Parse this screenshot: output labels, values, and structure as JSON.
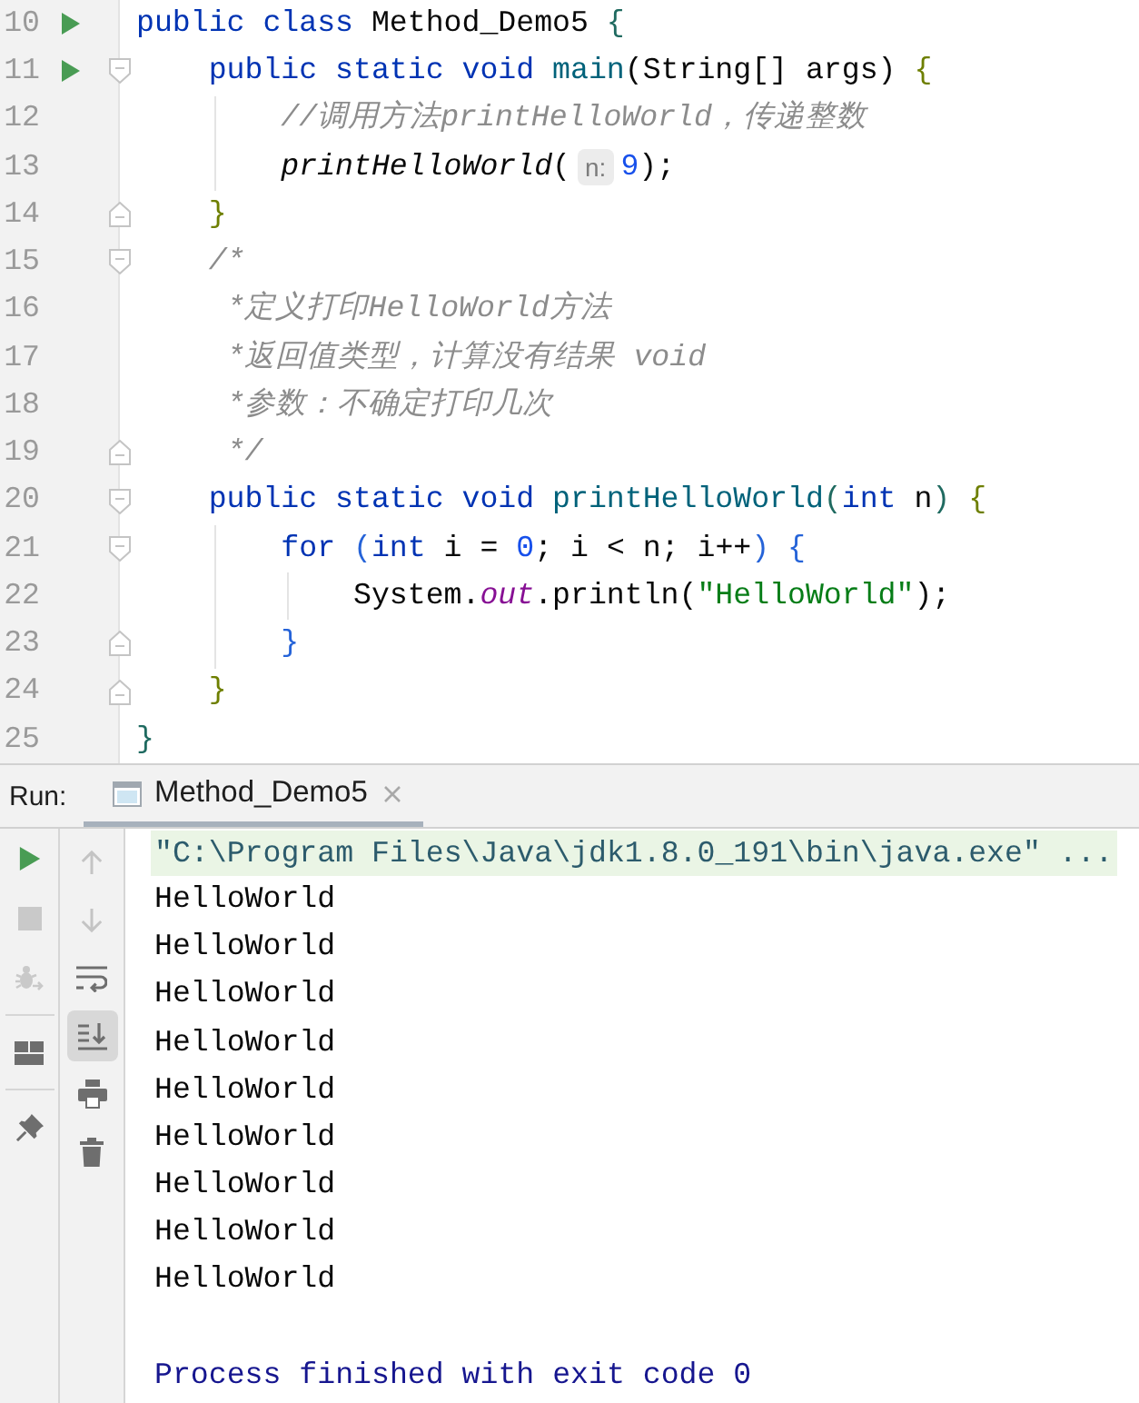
{
  "editor": {
    "lines": [
      {
        "number": "10",
        "run_marker": true,
        "tokens": [
          {
            "kind": "keyword",
            "text": "public class "
          },
          {
            "kind": "plain",
            "text": "Method_Demo5 "
          },
          {
            "kind": "brace-1",
            "text": "{"
          }
        ],
        "children": [
          {
            "number": "11",
            "run_marker": true,
            "fold_start": true,
            "tokens": [
              {
                "kind": "keyword",
                "text": "public static void "
              },
              {
                "kind": "method",
                "text": "main"
              },
              {
                "kind": "plain",
                "text": "(String[] args) "
              },
              {
                "kind": "brace-2",
                "text": "{"
              }
            ],
            "children": [
              {
                "number": "12",
                "tokens": [
                  {
                    "kind": "comment",
                    "text": "//调用方法printHelloWorld，传递整数"
                  }
                ]
              },
              {
                "number": "13",
                "tokens": [
                  {
                    "kind": "call",
                    "text": "printHelloWorld"
                  },
                  {
                    "kind": "plain",
                    "text": "("
                  },
                  {
                    "kind": "hint",
                    "text": "n:"
                  },
                  {
                    "kind": "number",
                    "text": "9"
                  },
                  {
                    "kind": "plain",
                    "text": ");"
                  }
                ]
              }
            ]
          },
          {
            "number": "14",
            "fold_end": true,
            "tokens": [
              {
                "kind": "brace-2",
                "text": "}"
              }
            ]
          },
          {
            "number": "15",
            "fold_start": true,
            "tokens": [
              {
                "kind": "comment",
                "text": "/*"
              }
            ]
          },
          {
            "number": "16",
            "tokens": [
              {
                "kind": "comment",
                "text": " *定义打印HelloWorld方法"
              }
            ]
          },
          {
            "number": "17",
            "tokens": [
              {
                "kind": "comment",
                "text": " *返回值类型，计算没有结果 void"
              }
            ]
          },
          {
            "number": "18",
            "tokens": [
              {
                "kind": "comment",
                "text": " *参数：不确定打印几次"
              }
            ]
          },
          {
            "number": "19",
            "fold_end": true,
            "tokens": [
              {
                "kind": "comment",
                "text": " */"
              }
            ]
          },
          {
            "number": "20",
            "fold_start": true,
            "tokens": [
              {
                "kind": "keyword",
                "text": "public static void "
              },
              {
                "kind": "method",
                "text": "printHelloWorld"
              },
              {
                "kind": "brace-1",
                "text": "("
              },
              {
                "kind": "keyword",
                "text": "int"
              },
              {
                "kind": "plain",
                "text": " n"
              },
              {
                "kind": "brace-1",
                "text": ")"
              },
              {
                "kind": "brace-2",
                "text": " {"
              }
            ],
            "children": [
              {
                "number": "21",
                "fold_start": true,
                "tokens": [
                  {
                    "kind": "keyword",
                    "text": "for "
                  },
                  {
                    "kind": "brace-3",
                    "text": "("
                  },
                  {
                    "kind": "keyword",
                    "text": "int"
                  },
                  {
                    "kind": "plain",
                    "text": " i = "
                  },
                  {
                    "kind": "number",
                    "text": "0"
                  },
                  {
                    "kind": "plain",
                    "text": "; i < n; i++"
                  },
                  {
                    "kind": "brace-3",
                    "text": ") {"
                  }
                ],
                "children": [
                  {
                    "number": "22",
                    "tokens": [
                      {
                        "kind": "plain",
                        "text": "System."
                      },
                      {
                        "kind": "field",
                        "text": "out"
                      },
                      {
                        "kind": "plain",
                        "text": ".println("
                      },
                      {
                        "kind": "string",
                        "text": "\"HelloWorld\""
                      },
                      {
                        "kind": "plain",
                        "text": ");"
                      }
                    ]
                  }
                ]
              },
              {
                "number": "23",
                "fold_end": true,
                "tokens": [
                  {
                    "kind": "brace-3",
                    "text": "}"
                  }
                ]
              }
            ]
          },
          {
            "number": "24",
            "fold_end": true,
            "tokens": [
              {
                "kind": "brace-2",
                "text": "}"
              }
            ]
          }
        ]
      },
      {
        "number": "25",
        "tokens": [
          {
            "kind": "brace-1",
            "text": "}"
          }
        ]
      }
    ]
  },
  "run_panel": {
    "label": "Run:",
    "tabs": [
      {
        "title": "Method_Demo5",
        "selected": true
      }
    ],
    "toolbar_1": {
      "groups": [
        {
          "buttons": [
            {
              "disabled": false
            },
            {
              "disabled": true
            },
            {
              "disabled": true
            }
          ]
        },
        {
          "buttons": [
            {
              "disabled": false
            }
          ]
        },
        {
          "buttons": [
            {
              "disabled": false
            }
          ]
        }
      ]
    },
    "toolbar_2": {
      "buttons": [
        {
          "disabled": true,
          "selected": false
        },
        {
          "disabled": true,
          "selected": false
        },
        {
          "disabled": false,
          "selected": false
        },
        {
          "disabled": false,
          "selected": true
        },
        {
          "disabled": false,
          "selected": false
        },
        {
          "disabled": false,
          "selected": false
        }
      ]
    },
    "output": [
      {
        "kind": "command",
        "text": "\"C:\\Program Files\\Java\\jdk1.8.0_191\\bin\\java.exe\" ..."
      },
      {
        "kind": "stdout",
        "text": "HelloWorld"
      },
      {
        "kind": "stdout",
        "text": "HelloWorld"
      },
      {
        "kind": "stdout",
        "text": "HelloWorld"
      },
      {
        "kind": "stdout",
        "text": "HelloWorld"
      },
      {
        "kind": "stdout",
        "text": "HelloWorld"
      },
      {
        "kind": "stdout",
        "text": "HelloWorld"
      },
      {
        "kind": "stdout",
        "text": "HelloWorld"
      },
      {
        "kind": "stdout",
        "text": "HelloWorld"
      },
      {
        "kind": "stdout",
        "text": "HelloWorld"
      },
      {
        "kind": "exit",
        "text": "Process finished with exit code 0"
      }
    ]
  }
}
